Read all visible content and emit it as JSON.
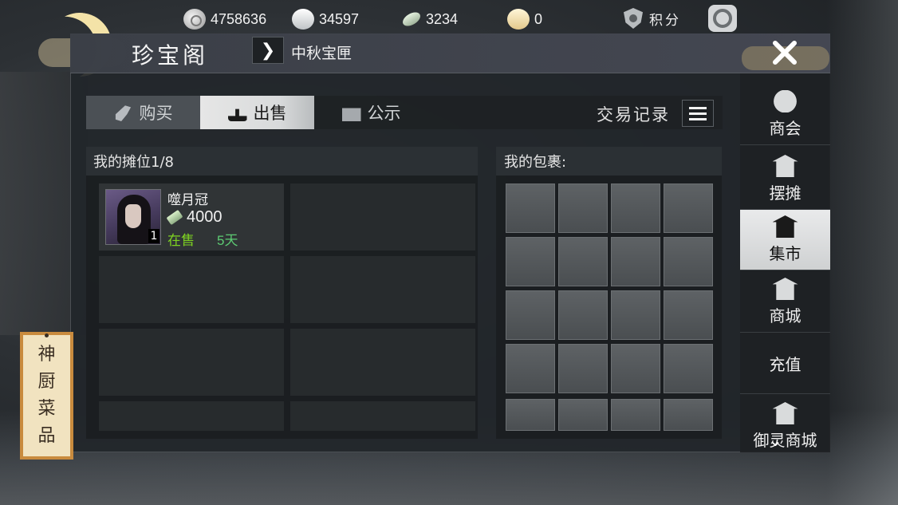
{
  "resources": [
    {
      "icon": "copper-coin-icon",
      "value": "4758636"
    },
    {
      "icon": "silver-ingot-icon",
      "value": "34597"
    },
    {
      "icon": "jade-ticket-icon",
      "value": "3234"
    },
    {
      "icon": "gold-ingot-icon",
      "value": "0"
    }
  ],
  "points": {
    "label": "积分",
    "icon": "points-shield-icon"
  },
  "header": {
    "title": "珍宝阁",
    "breadcrumb": "中秋宝匣"
  },
  "tabs": [
    {
      "label": "购买",
      "icon": "buy-icon"
    },
    {
      "label": "出售",
      "icon": "sell-icon",
      "active": true
    },
    {
      "label": "公示",
      "icon": "notice-icon"
    }
  ],
  "trade_record": {
    "label": "交易记录"
  },
  "stall": {
    "title": "我的摊位1/8",
    "item": {
      "name": "噬月冠",
      "quantity": "1",
      "price": "4000",
      "status": "在售",
      "days": "5天"
    }
  },
  "bag": {
    "title": "我的包裹:"
  },
  "sidebar": [
    {
      "label": "商会",
      "icon": "guild-emblem-icon"
    },
    {
      "label": "摆摊",
      "icon": "stall-icon"
    },
    {
      "label": "集市",
      "icon": "market-icon",
      "active": true
    },
    {
      "label": "商城",
      "icon": "shop-icon"
    },
    {
      "label": "充值",
      "icon": "money-bag-icon"
    },
    {
      "label": "御灵商城",
      "icon": "spirit-shop-icon"
    }
  ],
  "plaque": {
    "chars": [
      "神",
      "厨",
      "菜",
      "品"
    ]
  },
  "colors": {
    "on_sale": "#7ed321",
    "days": "#5dcb73",
    "active_tab": "#e6e6e6"
  }
}
